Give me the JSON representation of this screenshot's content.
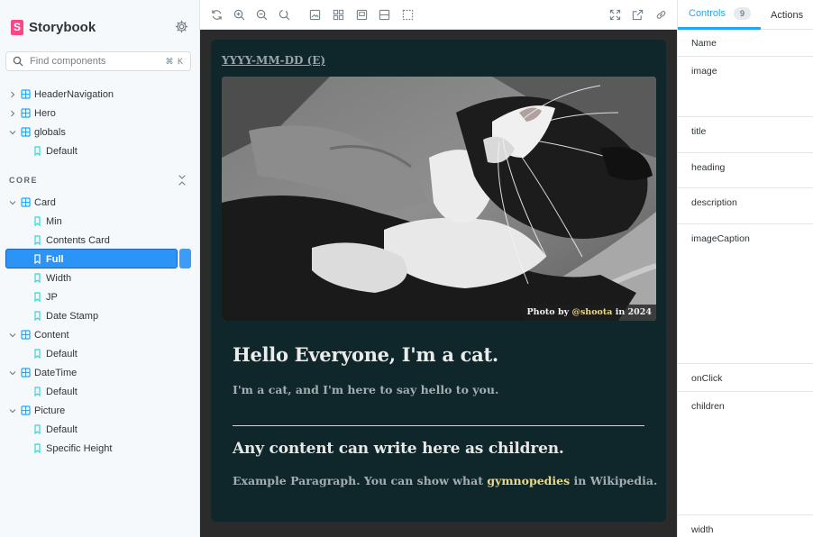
{
  "sidebar": {
    "brand": "Storybook",
    "search": {
      "placeholder": "Find components",
      "shortcut": "⌘ K"
    },
    "tree_top": [
      {
        "label": "HeaderNavigation",
        "kind": "component",
        "expanded": false
      },
      {
        "label": "Hero",
        "kind": "component",
        "expanded": false
      },
      {
        "label": "globals",
        "kind": "component",
        "expanded": true
      },
      {
        "label": "Default",
        "kind": "story"
      }
    ],
    "core_label": "CORE",
    "tree_core": [
      {
        "label": "Card",
        "kind": "component",
        "expanded": true
      },
      {
        "label": "Min",
        "kind": "story"
      },
      {
        "label": "Contents Card",
        "kind": "story"
      },
      {
        "label": "Full",
        "kind": "story",
        "selected": true
      },
      {
        "label": "Width",
        "kind": "story"
      },
      {
        "label": "JP",
        "kind": "story"
      },
      {
        "label": "Date Stamp",
        "kind": "story"
      },
      {
        "label": "Content",
        "kind": "component",
        "expanded": true
      },
      {
        "label": "Default",
        "kind": "story"
      },
      {
        "label": "DateTime",
        "kind": "component",
        "expanded": true
      },
      {
        "label": "Default",
        "kind": "story"
      },
      {
        "label": "Picture",
        "kind": "component",
        "expanded": true
      },
      {
        "label": "Default",
        "kind": "story"
      },
      {
        "label": "Specific Height",
        "kind": "story"
      }
    ]
  },
  "toolbar": {
    "icons": [
      "reload-icon",
      "zoom-in-icon",
      "zoom-out-icon",
      "zoom-reset-icon",
      "background-icon",
      "grid-icon",
      "viewport-icon",
      "measure-icon",
      "outline-icon"
    ],
    "right_icons": [
      "fullscreen-icon",
      "open-new-tab-icon",
      "copy-link-icon"
    ]
  },
  "card": {
    "date": "YYYY-MM-DD (E)",
    "caption_prefix": "Photo by",
    "caption_handle": "@shoota",
    "caption_suffix": "in 2024",
    "heading": "Hello Everyone, I'm a cat.",
    "description": "I'm a cat, and I'm here to say hello to you.",
    "subheading": "Any content can write here as children.",
    "paragraph_before": "Example Paragraph. You can show what",
    "paragraph_link": "gymnopedies",
    "paragraph_after": "in Wikipedia.",
    "colors": {
      "background": "#0f262b",
      "accent": "#e8d98c"
    }
  },
  "panel": {
    "tab_controls": "Controls",
    "controls_count": "9",
    "tab_actions": "Actions",
    "column_name": "Name",
    "props": [
      "image",
      "title",
      "heading",
      "description",
      "imageCaption",
      "onClick",
      "children",
      "width"
    ]
  }
}
